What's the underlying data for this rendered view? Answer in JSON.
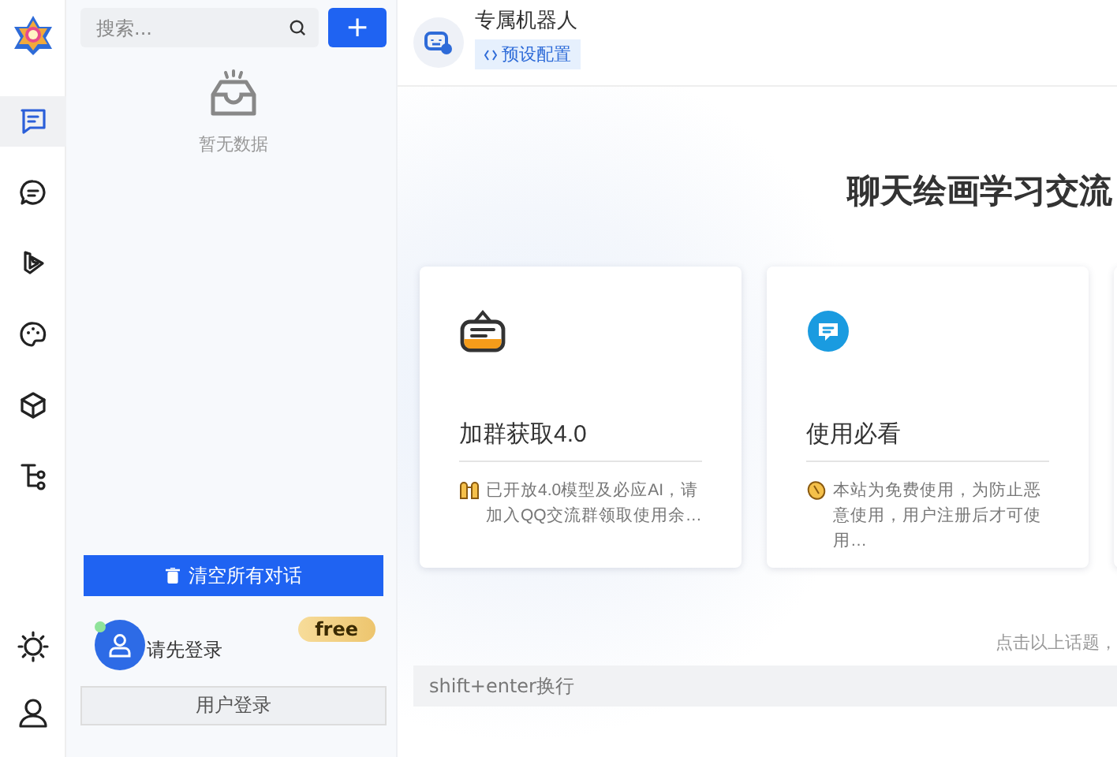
{
  "nav": {
    "items": [
      {
        "kind": "chat",
        "selected": true
      },
      {
        "kind": "message",
        "selected": false
      },
      {
        "kind": "bing",
        "selected": false
      },
      {
        "kind": "palette",
        "selected": false
      },
      {
        "kind": "cube",
        "selected": false
      },
      {
        "kind": "tree",
        "selected": false
      }
    ],
    "bottom": [
      {
        "kind": "sun"
      },
      {
        "kind": "user"
      }
    ]
  },
  "sidebar": {
    "search": {
      "placeholder": "搜索..."
    },
    "add_button": "+",
    "empty_text": "暂无数据",
    "clear_button": "清空所有对话",
    "user": {
      "name": "请先登录",
      "badge": "free",
      "online": true,
      "login_button": "用户登录"
    }
  },
  "header": {
    "title": "专属机器人",
    "tag": "预设配置"
  },
  "main": {
    "heading": "聊天绘画学习交流",
    "cards": [
      {
        "kind": "board",
        "title": "加群获取4.0",
        "text": "已开放4.0模型及必应AI，请加入QQ交流群领取使用余…"
      },
      {
        "kind": "bubble",
        "title": "使用必看",
        "text": "本站为免费使用，为防止恶意使用，用户注册后才可使用…"
      },
      {
        "kind": "blank"
      }
    ],
    "hint": "点击以上话题，",
    "input": {
      "placeholder": "shift+enter换行"
    }
  }
}
